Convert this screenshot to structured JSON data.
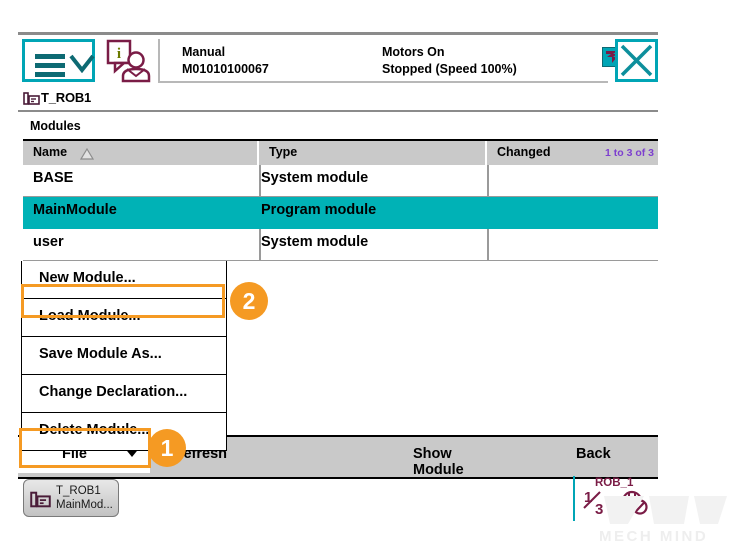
{
  "header": {
    "menu_icon": "hamburger-menu-icon",
    "chevron_icon": "chevron-down-icon",
    "user_icon": "info-operator-icon",
    "mode": "Manual",
    "controller_id": "M01010100067",
    "motors": "Motors On",
    "run_state": "Stopped (Speed 100%)",
    "status_icon": "program-pointer-icon",
    "close_icon": "close-icon"
  },
  "task": {
    "icon": "robot-task-icon",
    "label": "T_ROB1"
  },
  "modules": {
    "section_label": "Modules",
    "columns": [
      "Name",
      "Type",
      "Changed"
    ],
    "sort_icon": "sort-ascending-caret",
    "row_count": "1 to 3 of 3",
    "rows": [
      {
        "name": "BASE",
        "type": "System module",
        "changed": "",
        "selected": false
      },
      {
        "name": "MainModule",
        "type": "Program module",
        "changed": "",
        "selected": true
      },
      {
        "name": "user",
        "type": "System module",
        "changed": "",
        "selected": false
      }
    ]
  },
  "context_menu": {
    "items": [
      {
        "label": "New Module..."
      },
      {
        "label": "Load Module..."
      },
      {
        "label": "Save Module As..."
      },
      {
        "label": "Change Declaration..."
      },
      {
        "label": "Delete Module..."
      }
    ]
  },
  "button_bar": {
    "file": "File",
    "file_caret_icon": "caret-down-icon",
    "refresh": "Refresh",
    "show_module": "Show Module",
    "back": "Back"
  },
  "taskbar": {
    "item_icon": "robot-task-icon",
    "item_line1": "T_ROB1",
    "item_line2": "MainMod...",
    "rob_name": "ROB_1",
    "rob_fraction_numerator": "1",
    "rob_fraction_denominator": "3",
    "rob_icon": "no-motion-supervision-icon"
  },
  "watermark": {
    "text": "MECH MIND",
    "logo_icon": "mech-mind-logo-icon"
  },
  "annotations": {
    "badge_one": "1",
    "badge_two": "2",
    "highlight_color": "#f59a23"
  },
  "colors": {
    "accent_teal": "#00a5b5",
    "selection_teal": "#00b2b6",
    "maroon": "#7a1c46",
    "purple_count": "#7d3fcf",
    "toolbar_gray": "#c9c9c9"
  }
}
